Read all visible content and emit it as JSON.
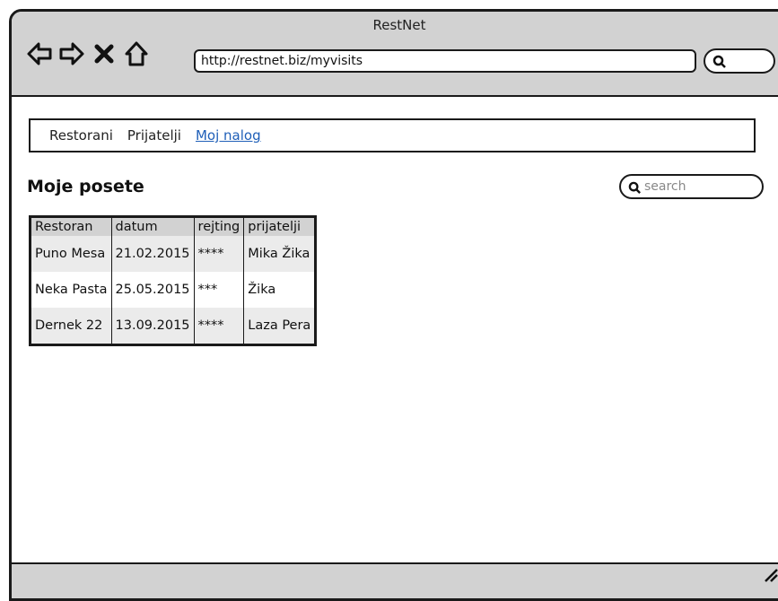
{
  "window": {
    "title": "RestNet"
  },
  "toolbar": {
    "url": "http://restnet.biz/myvisits",
    "icons": [
      "back-arrow-icon",
      "forward-arrow-icon",
      "close-icon",
      "home-icon",
      "search-icon"
    ]
  },
  "nav": {
    "items": [
      {
        "label": "Restorani"
      },
      {
        "label": "Prijatelji"
      },
      {
        "label": "Moj nalog",
        "active": true
      }
    ],
    "active_color": "#1f5fb8"
  },
  "page": {
    "heading": "Moje posete",
    "search_placeholder": "search"
  },
  "table": {
    "headers": [
      "Restoran",
      "datum",
      "rejting",
      "prijatelji"
    ],
    "rows": [
      [
        "Puno Mesa",
        "21.02.2015",
        "****",
        "Mika Žika"
      ],
      [
        "Neka Pasta",
        "25.05.2015",
        "***",
        "Žika"
      ],
      [
        "Dernek 22",
        "13.09.2015",
        "****",
        "Laza Pera"
      ]
    ]
  }
}
